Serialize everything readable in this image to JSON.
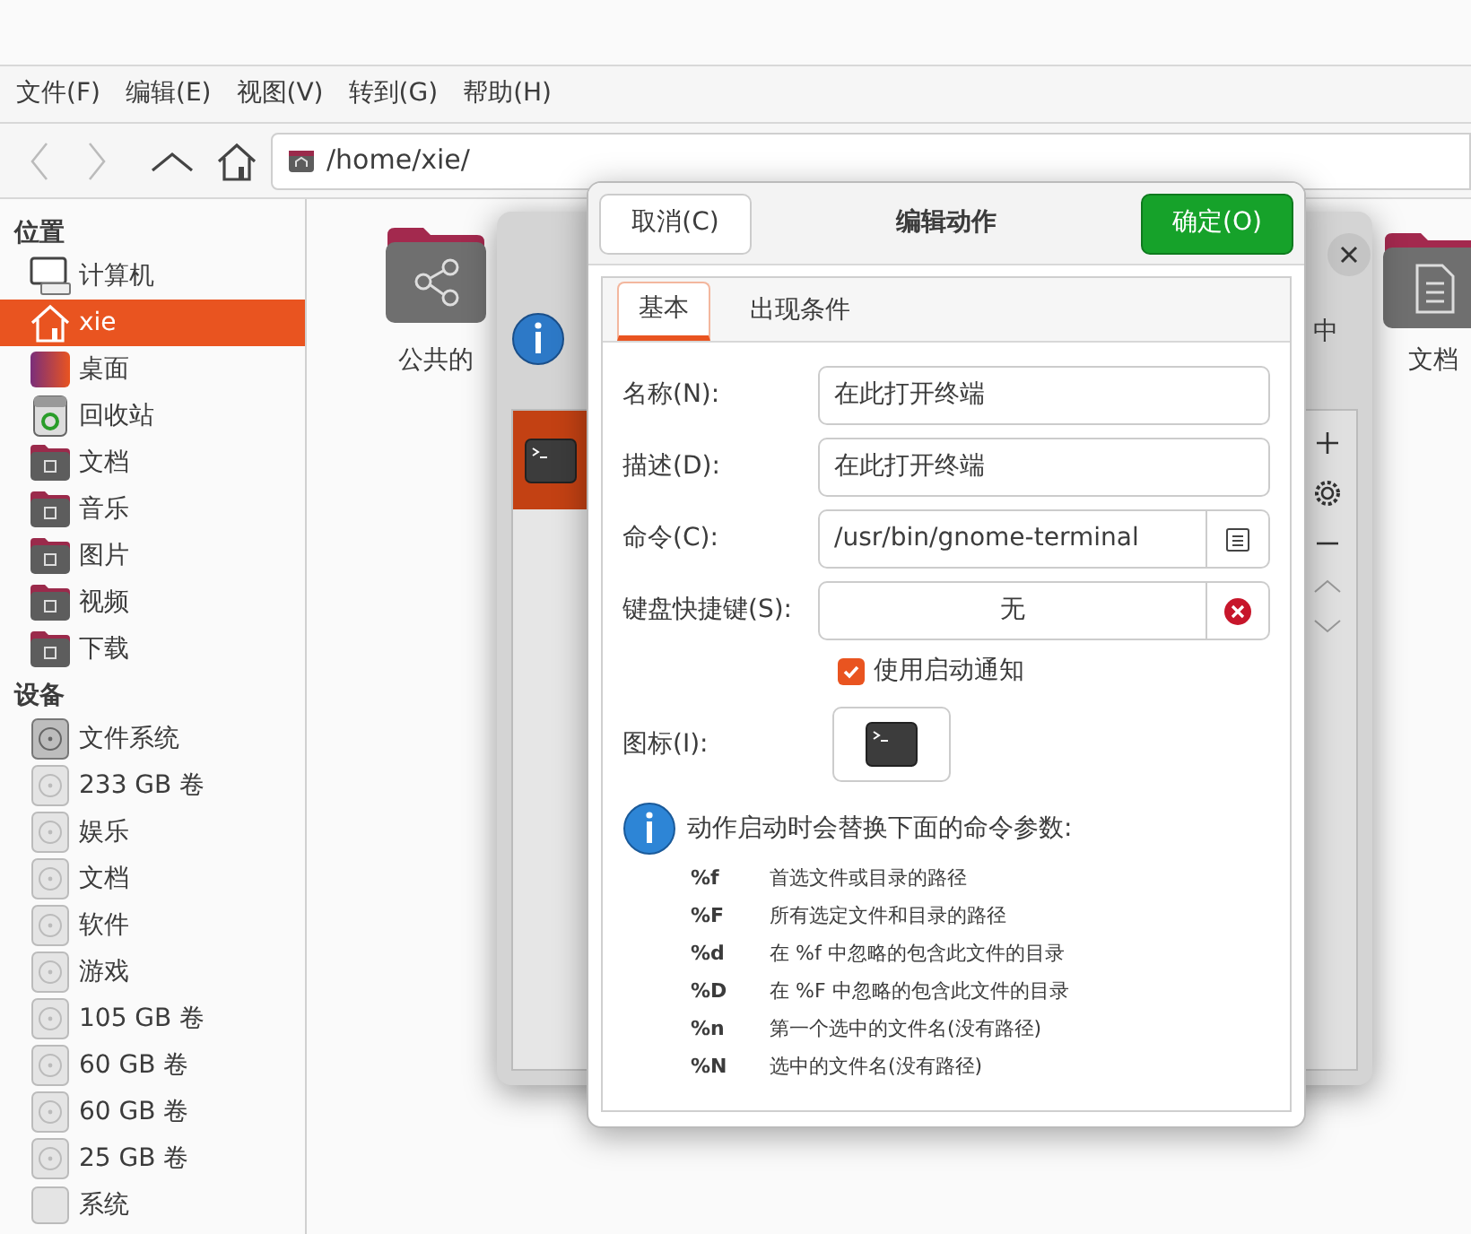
{
  "menu": [
    "文件(F)",
    "编辑(E)",
    "视图(V)",
    "转到(G)",
    "帮助(H)"
  ],
  "toolbar": {
    "path": "/home/xie/"
  },
  "sidebar": {
    "sections": [
      {
        "title": "位置",
        "items": [
          {
            "label": "计算机",
            "kind": "computer",
            "selected": false
          },
          {
            "label": "xie",
            "kind": "home",
            "selected": true
          },
          {
            "label": "桌面",
            "kind": "desktop",
            "selected": false
          },
          {
            "label": "回收站",
            "kind": "trash",
            "selected": false
          },
          {
            "label": "文档",
            "kind": "folder",
            "selected": false
          },
          {
            "label": "音乐",
            "kind": "folder",
            "selected": false
          },
          {
            "label": "图片",
            "kind": "folder",
            "selected": false
          },
          {
            "label": "视频",
            "kind": "folder",
            "selected": false
          },
          {
            "label": "下载",
            "kind": "folder",
            "selected": false
          }
        ]
      },
      {
        "title": "设备",
        "items": [
          {
            "label": "文件系统",
            "kind": "drive",
            "mounted": true,
            "selected": false
          },
          {
            "label": "233 GB 卷",
            "kind": "drive",
            "mounted": false,
            "selected": false
          },
          {
            "label": "娱乐",
            "kind": "drive",
            "mounted": false,
            "selected": false
          },
          {
            "label": "文档",
            "kind": "drive",
            "mounted": false,
            "selected": false
          },
          {
            "label": "软件",
            "kind": "drive",
            "mounted": false,
            "selected": false
          },
          {
            "label": "游戏",
            "kind": "drive",
            "mounted": false,
            "selected": false
          },
          {
            "label": "105 GB 卷",
            "kind": "drive",
            "mounted": false,
            "selected": false
          },
          {
            "label": "60 GB 卷",
            "kind": "drive",
            "mounted": false,
            "selected": false
          },
          {
            "label": "60 GB 卷",
            "kind": "drive",
            "mounted": false,
            "selected": false
          },
          {
            "label": "25 GB 卷",
            "kind": "drive",
            "mounted": false,
            "selected": false
          },
          {
            "label": "系统",
            "kind": "ssd",
            "selected": false
          }
        ]
      }
    ]
  },
  "content": {
    "folders": [
      {
        "label": "公共的",
        "kind": "share"
      },
      {
        "label": "文档",
        "kind": "document"
      }
    ]
  },
  "back_dialog": {
    "info_right": "中"
  },
  "dialog": {
    "cancel": "取消(C)",
    "title": "编辑动作",
    "ok": "确定(O)",
    "tabs": [
      {
        "label": "基本",
        "selected": true
      },
      {
        "label": "出现条件",
        "selected": false
      }
    ],
    "fields": [
      {
        "label": "名称(N):",
        "value": "在此打开终端",
        "kind": "text"
      },
      {
        "label": "描述(D):",
        "value": "在此打开终端",
        "kind": "text"
      },
      {
        "label": "命令(C):",
        "value": "/usr/bin/gnome-terminal",
        "kind": "file"
      },
      {
        "label": "键盘快捷键(S):",
        "value": "无",
        "kind": "shortcut"
      }
    ],
    "startup_notify": {
      "label": "使用启动通知",
      "checked": true
    },
    "icon_label": "图标(I):",
    "info_title": "动作启动时会替换下面的命令参数:",
    "params": [
      {
        "code": "%f",
        "text": "首选文件或目录的路径"
      },
      {
        "code": "%F",
        "text": "所有选定文件和目录的路径"
      },
      {
        "code": "%d",
        "text": "在 %f 中忽略的包含此文件的目录"
      },
      {
        "code": "%D",
        "text": "在 %F 中忽略的包含此文件的目录"
      },
      {
        "code": "%n",
        "text": "第一个选中的文件名(没有路径)"
      },
      {
        "code": "%N",
        "text": "选中的文件名(没有路径)"
      }
    ]
  }
}
